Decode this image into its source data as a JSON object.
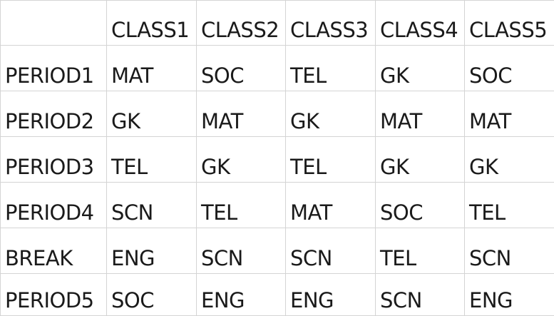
{
  "header": {
    "corner": "",
    "columns": [
      "CLASS1",
      "CLASS2",
      "CLASS3",
      "CLASS4",
      "CLASS5"
    ]
  },
  "rows": [
    {
      "label": "PERIOD1",
      "cells": [
        "MAT",
        "SOC",
        "TEL",
        "GK",
        "SOC"
      ]
    },
    {
      "label": "PERIOD2",
      "cells": [
        "GK",
        "MAT",
        "GK",
        "MAT",
        "MAT"
      ]
    },
    {
      "label": "PERIOD3",
      "cells": [
        "TEL",
        "GK",
        "TEL",
        "GK",
        "GK"
      ]
    },
    {
      "label": "PERIOD4",
      "cells": [
        "SCN",
        "TEL",
        "MAT",
        "SOC",
        "TEL"
      ]
    },
    {
      "label": "BREAK",
      "cells": [
        "ENG",
        "SCN",
        "SCN",
        "TEL",
        "SCN"
      ]
    },
    {
      "label": "PERIOD5",
      "cells": [
        "SOC",
        "ENG",
        "ENG",
        "SCN",
        "ENG"
      ]
    }
  ]
}
